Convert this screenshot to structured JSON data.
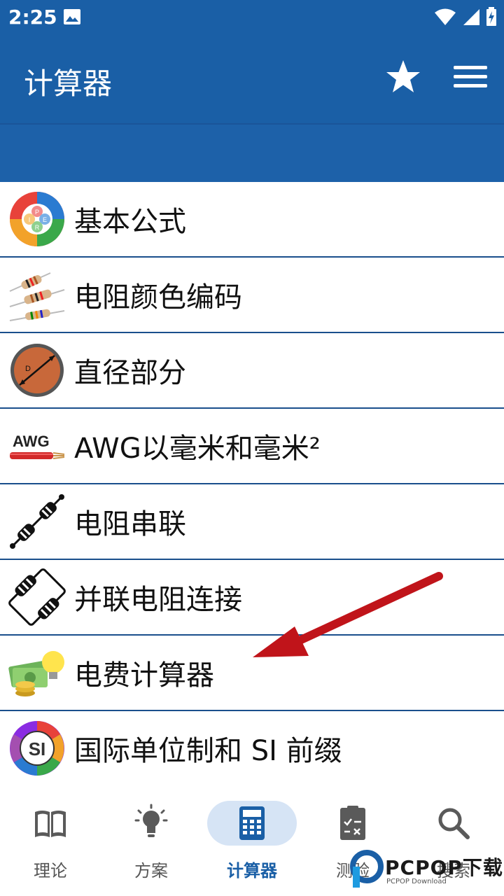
{
  "status_bar": {
    "time": "2:25",
    "icons": [
      "image-icon",
      "wifi-icon",
      "signal-icon",
      "battery-charging-icon"
    ]
  },
  "app_bar": {
    "title": "计算器",
    "actions": [
      "star-icon",
      "menu-icon"
    ]
  },
  "list": {
    "items": [
      {
        "label": "基本公式",
        "icon": "formula-wheel-icon"
      },
      {
        "label": "电阻颜色编码",
        "icon": "resistor-color-icon"
      },
      {
        "label": "直径部分",
        "icon": "diameter-icon"
      },
      {
        "label": "AWG以毫米和毫米²",
        "icon": "awg-wire-icon"
      },
      {
        "label": "电阻串联",
        "icon": "resistors-series-icon"
      },
      {
        "label": "并联电阻连接",
        "icon": "resistors-parallel-icon"
      },
      {
        "label": "电费计算器",
        "icon": "electricity-bill-icon"
      },
      {
        "label": "国际单位制和 SI 前缀",
        "icon": "si-units-icon"
      }
    ]
  },
  "bottom_nav": {
    "items": [
      {
        "label": "理论",
        "icon": "book-icon",
        "active": false
      },
      {
        "label": "方案",
        "icon": "lightbulb-icon",
        "active": false
      },
      {
        "label": "计算器",
        "icon": "calculator-icon",
        "active": true
      },
      {
        "label": "测验",
        "icon": "clipboard-check-icon",
        "active": false
      },
      {
        "label": "搜索",
        "icon": "search-icon",
        "active": false
      }
    ]
  },
  "watermark": {
    "text": "PCPOP下载",
    "subtext": "PCPOP Download"
  },
  "colors": {
    "primary": "#1a5fa6",
    "nav_active_bg": "#d6e4f5",
    "divider": "#1a4f8c",
    "arrow": "#c0141a"
  }
}
